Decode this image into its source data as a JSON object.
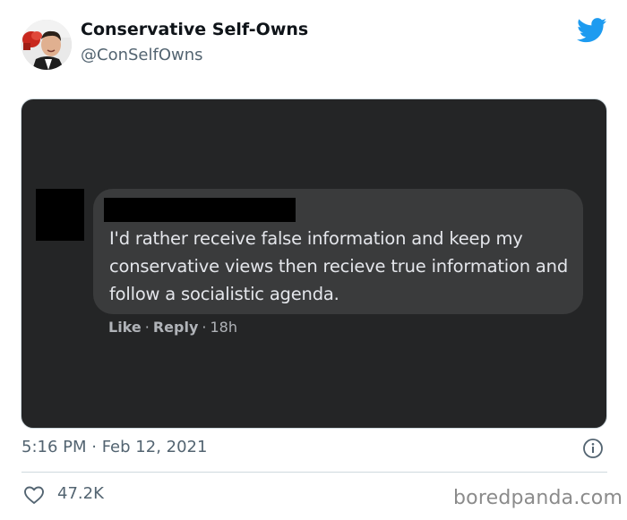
{
  "tweet": {
    "author": {
      "display_name": "Conservative Self-Owns",
      "handle": "@ConSelfOwns",
      "avatar_icon": "person-boxing-glove-avatar"
    },
    "brand_icon": "twitter-bird-icon",
    "brand_color": "#1d9bf0",
    "timestamp": "5:16 PM · Feb 12, 2021",
    "likes": "47.2K"
  },
  "screenshot": {
    "background": "#242526",
    "comment": {
      "text": "I'd rather receive false information and keep my conservative views then recieve true information and follow a socialistic agenda.",
      "bubble_color": "#3a3b3c",
      "text_color": "#e4e6eb"
    },
    "actions": {
      "like": "Like",
      "reply": "Reply",
      "time": "18h",
      "separator": "·"
    }
  },
  "watermark": "boredpanda.com"
}
